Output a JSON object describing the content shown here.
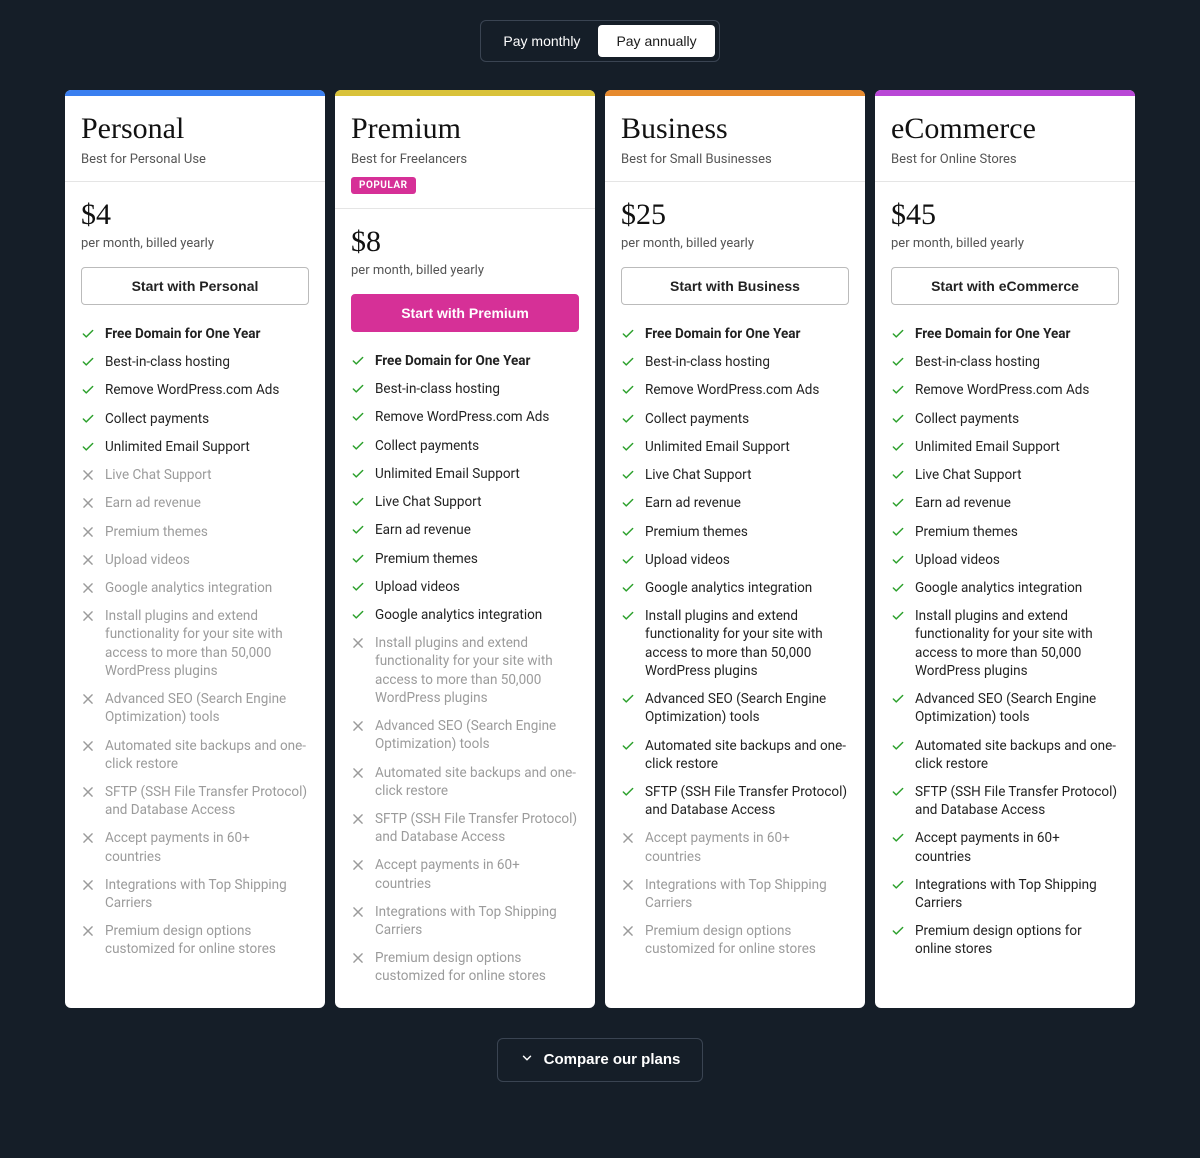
{
  "toggle": {
    "monthly": "Pay monthly",
    "annually": "Pay annually",
    "active": "annually"
  },
  "features": [
    {
      "label": "Free Domain for One Year",
      "bold": true
    },
    {
      "label": "Best-in-class hosting"
    },
    {
      "label": "Remove WordPress.com Ads"
    },
    {
      "label": "Collect payments"
    },
    {
      "label": "Unlimited Email Support"
    },
    {
      "label": "Live Chat Support"
    },
    {
      "label": "Earn ad revenue"
    },
    {
      "label": "Premium themes"
    },
    {
      "label": "Upload videos"
    },
    {
      "label": "Google analytics integration"
    },
    {
      "label": "Install plugins and extend functionality for your site with access to more than 50,000 WordPress plugins"
    },
    {
      "label": "Advanced SEO (Search Engine Optimization) tools"
    },
    {
      "label": "Automated site backups and one-click restore"
    },
    {
      "label": "SFTP (SSH File Transfer Protocol) and Database Access"
    },
    {
      "label": "Accept payments in 60+ countries"
    },
    {
      "label": "Integrations with Top Shipping Carriers"
    },
    {
      "label": "Premium design options customized for online stores"
    }
  ],
  "ecommerce_last_feature": "Premium design options for online stores",
  "plans": [
    {
      "id": "personal",
      "title": "Personal",
      "sub": "Best for Personal Use",
      "price": "$4",
      "term": "per month, billed yearly",
      "cta": "Start with Personal",
      "bar": "#3a7ff0",
      "popular": false,
      "cta_primary": false,
      "enabled_count": 5
    },
    {
      "id": "premium",
      "title": "Premium",
      "sub": "Best for Freelancers",
      "price": "$8",
      "term": "per month, billed yearly",
      "cta": "Start with Premium",
      "bar": "#d9c23a",
      "popular": true,
      "popular_label": "POPULAR",
      "cta_primary": true,
      "enabled_count": 10
    },
    {
      "id": "business",
      "title": "Business",
      "sub": "Best for Small Businesses",
      "price": "$25",
      "term": "per month, billed yearly",
      "cta": "Start with Business",
      "bar": "#e68a2e",
      "popular": false,
      "cta_primary": false,
      "enabled_count": 14
    },
    {
      "id": "ecommerce",
      "title": "eCommerce",
      "sub": "Best for Online Stores",
      "price": "$45",
      "term": "per month, billed yearly",
      "cta": "Start with eCommerce",
      "bar": "#b947d6",
      "popular": false,
      "cta_primary": false,
      "enabled_count": 17
    }
  ],
  "compare": "Compare our plans"
}
